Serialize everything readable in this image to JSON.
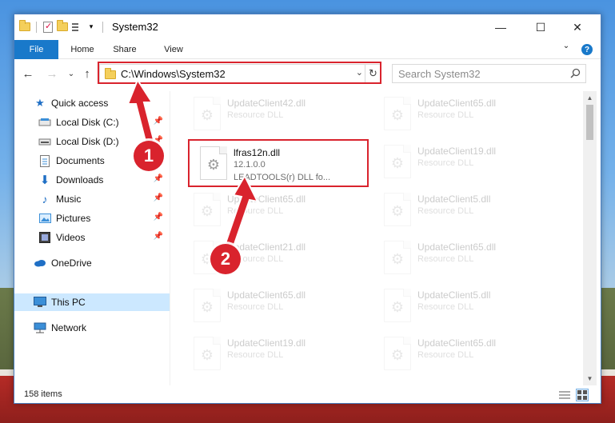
{
  "window": {
    "title": "System32",
    "controls": {
      "minimize": "—",
      "maximize": "☐",
      "close": "✕"
    }
  },
  "ribbon": {
    "tabs": [
      "File",
      "Home",
      "Share",
      "View"
    ],
    "help": "?"
  },
  "address": {
    "path": "C:\\Windows\\System32",
    "refresh": "↻"
  },
  "search": {
    "placeholder": "Search System32"
  },
  "navigation": {
    "back": "←",
    "forward": "→",
    "recent": "⌄",
    "up": "↑"
  },
  "sidebar": {
    "quick_access": "Quick access",
    "items": [
      {
        "label": "Local Disk (C:)",
        "icon": "drive-icon",
        "pinned": true
      },
      {
        "label": "Local Disk (D:)",
        "icon": "drive-icon",
        "pinned": true
      },
      {
        "label": "Documents",
        "icon": "documents-icon",
        "pinned": true
      },
      {
        "label": "Downloads",
        "icon": "downloads-icon",
        "pinned": true
      },
      {
        "label": "Music",
        "icon": "music-icon",
        "pinned": true
      },
      {
        "label": "Pictures",
        "icon": "pictures-icon",
        "pinned": true
      },
      {
        "label": "Videos",
        "icon": "videos-icon",
        "pinned": true
      }
    ],
    "onedrive": "OneDrive",
    "this_pc": "This PC",
    "network": "Network"
  },
  "files": {
    "highlighted": {
      "name": "lfras12n.dll",
      "version": "12.1.0.0",
      "company": "LEADTOOLS(r) DLL fo..."
    },
    "background_left": [
      {
        "name": "UpdateClient42.dll",
        "desc": "Resource DLL"
      },
      {
        "name": "UpdateClient65.dll",
        "desc": "Resource DLL"
      },
      {
        "name": "UpdateClient21.dll",
        "desc": "Resource DLL"
      },
      {
        "name": "UpdateClient65.dll",
        "desc": "Resource DLL"
      },
      {
        "name": "UpdateClient19.dll",
        "desc": "Resource DLL"
      }
    ],
    "background_right": [
      {
        "name": "UpdateClient65.dll",
        "desc": "Resource DLL"
      },
      {
        "name": "UpdateClient19.dll",
        "desc": "Resource DLL"
      },
      {
        "name": "UpdateClient5.dll",
        "desc": "Resource DLL"
      },
      {
        "name": "UpdateClient65.dll",
        "desc": "Resource DLL"
      },
      {
        "name": "UpdateClient5.dll",
        "desc": "Resource DLL"
      },
      {
        "name": "UpdateClient65.dll",
        "desc": "Resource DLL"
      }
    ]
  },
  "status": {
    "item_count": "158 items"
  },
  "annotations": {
    "step1": "1",
    "step2": "2"
  },
  "colors": {
    "accent": "#1979ca",
    "highlight": "#d9232d",
    "selected": "#cce8ff"
  }
}
